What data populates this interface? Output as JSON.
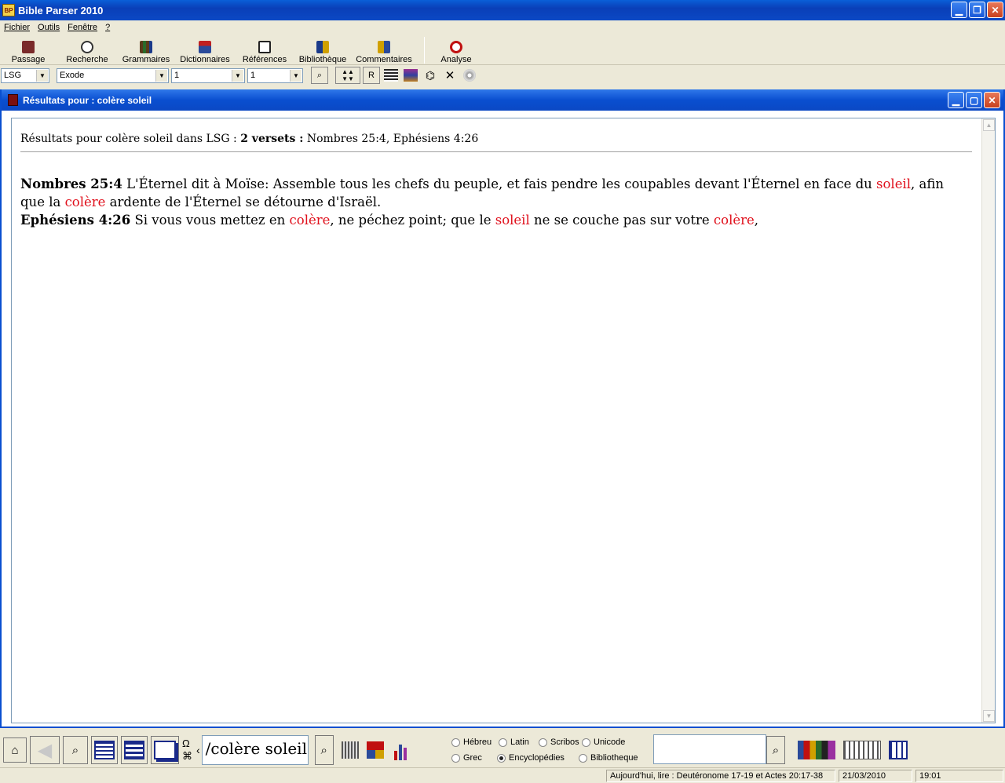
{
  "app": {
    "title": "Bible Parser 2010",
    "icon_label": "BP"
  },
  "menu": [
    "Fichier",
    "Outils",
    "Fenêtre",
    "?"
  ],
  "toolbar": [
    {
      "label": "Passage",
      "icon": "book-icon",
      "color": "#7a2a2a"
    },
    {
      "label": "Recherche",
      "icon": "magnifier-icon",
      "color": "#333333"
    },
    {
      "label": "Grammaires",
      "icon": "books-icon",
      "color": "#5a3a1a"
    },
    {
      "label": "Dictionnaires",
      "icon": "dictionary-icon",
      "color": "#2a4a9a"
    },
    {
      "label": "Références",
      "icon": "scroll-icon",
      "color": "#222222"
    },
    {
      "label": "Bibliothèque",
      "icon": "library-icon",
      "color": "#1a3a8a"
    },
    {
      "label": "Commentaires",
      "icon": "commentary-icon",
      "color": "#d0a000"
    },
    {
      "label": "Analyse",
      "icon": "analysis-icon",
      "color": "#c01010"
    }
  ],
  "selectors": {
    "version": "LSG",
    "book": "Exode",
    "chapter": "1",
    "verse": "1",
    "r_button": "R"
  },
  "child_window": {
    "title": "Résultats pour : colère soleil"
  },
  "results": {
    "summary_prefix": "Résultats pour colère soleil dans LSG : ",
    "summary_count": "2 versets :",
    "summary_refs": " Nombres 25:4, Ephésiens 4:26",
    "verses": [
      {
        "ref": "Nombres 25:4",
        "parts": [
          {
            "t": " L'Éternel dit à Moïse: Assemble tous les chefs du peuple, et fais pendre les coupables devant l'Éternel en face du "
          },
          {
            "t": "soleil",
            "hl": true
          },
          {
            "t": ", afin que la "
          },
          {
            "t": "colère",
            "hl": true
          },
          {
            "t": " ardente de l'Éternel se détourne d'Israël."
          }
        ]
      },
      {
        "ref": "Ephésiens 4:26",
        "parts": [
          {
            "t": " Si vous vous mettez en "
          },
          {
            "t": "colère",
            "hl": true
          },
          {
            "t": ", ne péchez point; que le "
          },
          {
            "t": "soleil",
            "hl": true
          },
          {
            "t": " ne se couche pas sur votre "
          },
          {
            "t": "colère",
            "hl": true
          },
          {
            "t": ","
          }
        ]
      }
    ]
  },
  "bottom": {
    "search_text": "/colère soleil",
    "omega": "Ω",
    "chevron": "‹",
    "radios": [
      {
        "label": "Hébreu",
        "checked": false
      },
      {
        "label": "Latin",
        "checked": false
      },
      {
        "label": "Scribos",
        "checked": false
      },
      {
        "label": "Unicode",
        "checked": false
      },
      {
        "label": "Grec",
        "checked": false
      },
      {
        "label": "Encyclopédies",
        "checked": true
      },
      {
        "label": "Bibliotheque",
        "checked": false
      }
    ]
  },
  "status": {
    "reading": "Aujourd'hui, lire : Deutéronome 17-19 et Actes 20:17-38",
    "date": "21/03/2010",
    "time": "19:01"
  },
  "colors": {
    "highlight": "#e0101c",
    "titlebar": "#0a4fd0"
  }
}
